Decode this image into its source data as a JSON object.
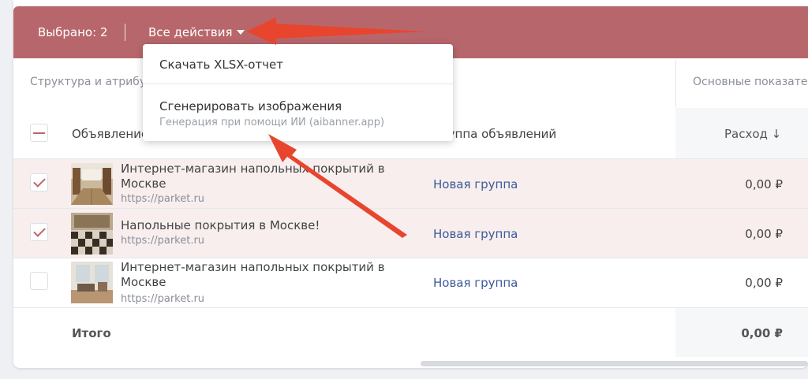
{
  "actionbar": {
    "selected_text": "Выбрано: 2",
    "all_actions_label": "Все действия"
  },
  "dropdown": {
    "items": [
      {
        "label": "Скачать XLSX-отчет"
      },
      {
        "label": "Сгенерировать изображения",
        "sublabel": "Генерация при помощи ИИ (aibanner.app)"
      }
    ]
  },
  "column_groups": {
    "structure": "Структура и атрибуты",
    "main_metrics": "Основные показатели"
  },
  "headers": {
    "ad": "Объявление",
    "ad_group": "Группа объявлений",
    "spend": "Расход ↓"
  },
  "rows": [
    {
      "title": "Интернет-магазин напольных покрытий в Москве",
      "url": "https://parket.ru",
      "group": "Новая группа",
      "spend": "0,00 ₽",
      "checked": true
    },
    {
      "title": "Напольные покрытия в Москве!",
      "url": "https://parket.ru",
      "group": "Новая группа",
      "spend": "0,00 ₽",
      "checked": true
    },
    {
      "title": "Интернет-магазин напольных покрытий в Москве",
      "url": "https://parket.ru",
      "group": "Новая группа",
      "spend": "0,00 ₽",
      "checked": false
    }
  ],
  "total": {
    "label": "Итого",
    "value": "0,00 ₽"
  },
  "colors": {
    "accent": "#b7676b",
    "link": "#3c5a99",
    "annotation_arrow": "#e8452f"
  }
}
